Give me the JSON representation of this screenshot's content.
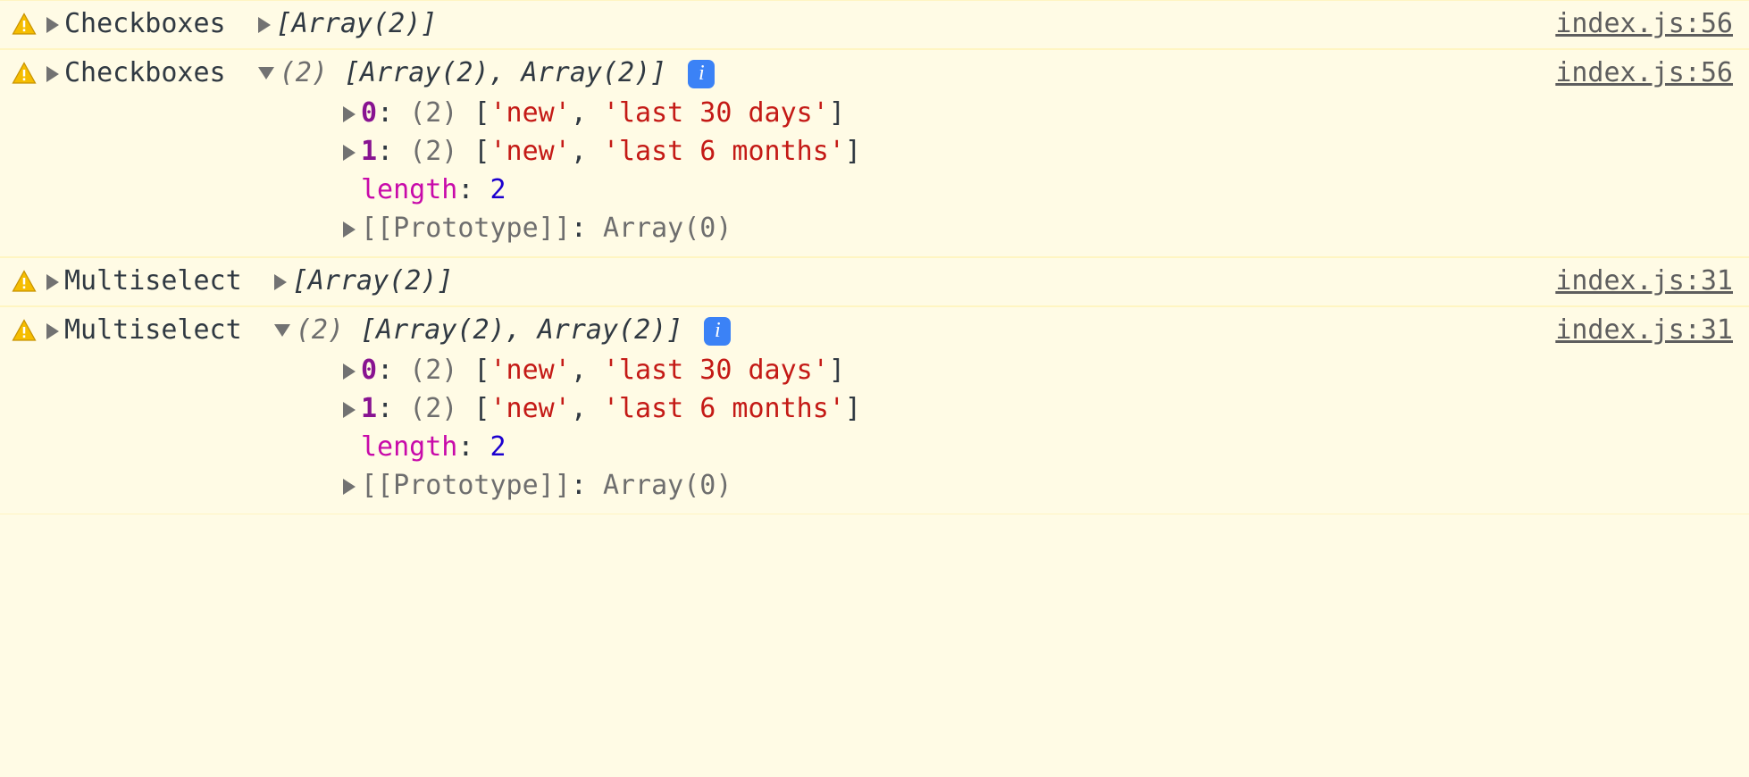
{
  "entries": [
    {
      "label": "Checkboxes",
      "expanded": false,
      "summary_collapsed": "[Array(2)]",
      "source": "index.js:56"
    },
    {
      "label": "Checkboxes",
      "expanded": true,
      "summary_count": "(2)",
      "summary_expanded": "[Array(2), Array(2)]",
      "info_badge": "i",
      "source": "index.js:56",
      "children": [
        {
          "type": "index",
          "key": "0",
          "count": "(2)",
          "values": [
            "'new'",
            "'last 30 days'"
          ]
        },
        {
          "type": "index",
          "key": "1",
          "count": "(2)",
          "values": [
            "'new'",
            "'last 6 months'"
          ]
        },
        {
          "type": "length",
          "key": "length",
          "value": "2"
        },
        {
          "type": "proto",
          "key": "[[Prototype]]",
          "value": "Array(0)"
        }
      ]
    },
    {
      "label": "Multiselect",
      "expanded": false,
      "summary_collapsed": "[Array(2)]",
      "source": "index.js:31"
    },
    {
      "label": "Multiselect",
      "expanded": true,
      "summary_count": "(2)",
      "summary_expanded": "[Array(2), Array(2)]",
      "info_badge": "i",
      "source": "index.js:31",
      "children": [
        {
          "type": "index",
          "key": "0",
          "count": "(2)",
          "values": [
            "'new'",
            "'last 30 days'"
          ]
        },
        {
          "type": "index",
          "key": "1",
          "count": "(2)",
          "values": [
            "'new'",
            "'last 6 months'"
          ]
        },
        {
          "type": "length",
          "key": "length",
          "value": "2"
        },
        {
          "type": "proto",
          "key": "[[Prototype]]",
          "value": "Array(0)"
        }
      ]
    }
  ]
}
